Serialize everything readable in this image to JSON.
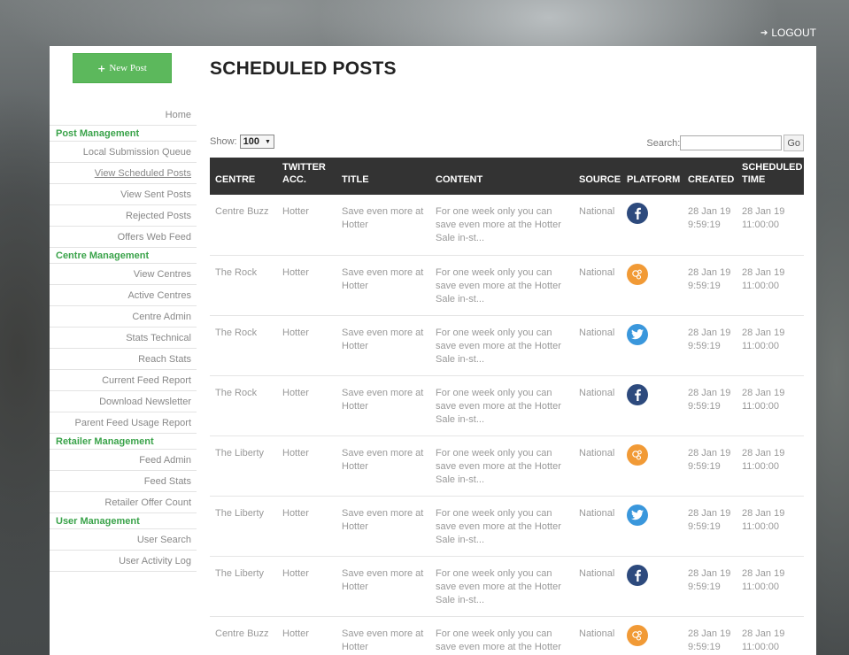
{
  "header": {
    "logout_label": "LOGOUT",
    "logout_icon": "sign-out-icon"
  },
  "sidebar": {
    "new_post_label": "New Post",
    "new_post_icon": "plus-icon",
    "items": [
      {
        "type": "link",
        "label": "Home"
      },
      {
        "type": "heading",
        "label": "Post Management"
      },
      {
        "type": "link",
        "label": "Local Submission Queue"
      },
      {
        "type": "link",
        "label": "View Scheduled Posts",
        "active": true
      },
      {
        "type": "link",
        "label": "View Sent Posts"
      },
      {
        "type": "link",
        "label": "Rejected Posts"
      },
      {
        "type": "link",
        "label": "Offers Web Feed"
      },
      {
        "type": "heading",
        "label": "Centre Management"
      },
      {
        "type": "link",
        "label": "View Centres"
      },
      {
        "type": "link",
        "label": "Active Centres"
      },
      {
        "type": "link",
        "label": "Centre Admin"
      },
      {
        "type": "link",
        "label": "Stats Technical"
      },
      {
        "type": "link",
        "label": "Reach Stats"
      },
      {
        "type": "link",
        "label": "Current Feed Report"
      },
      {
        "type": "link",
        "label": "Download Newsletter"
      },
      {
        "type": "link",
        "label": "Parent Feed Usage Report"
      },
      {
        "type": "heading",
        "label": "Retailer Management"
      },
      {
        "type": "link",
        "label": "Feed Admin"
      },
      {
        "type": "link",
        "label": "Feed Stats"
      },
      {
        "type": "link",
        "label": "Retailer Offer Count"
      },
      {
        "type": "heading",
        "label": "User Management"
      },
      {
        "type": "link",
        "label": "User Search"
      },
      {
        "type": "link",
        "label": "User Activity Log"
      }
    ]
  },
  "main": {
    "title": "SCHEDULED POSTS",
    "show_label": "Show:",
    "show_value": "100",
    "search_label": "Search:",
    "search_value": "",
    "go_label": "Go",
    "columns": [
      "CENTRE",
      "TWITTER ACC.",
      "TITLE",
      "CONTENT",
      "SOURCE",
      "PLATFORM",
      "CREATED",
      "SCHEDULED TIME"
    ],
    "rows": [
      {
        "centre": "Centre Buzz",
        "twitter": "Hotter",
        "title": "Save even more at Hotter",
        "content": "For one week only you can save even more at the Hotter Sale in-st...",
        "source": "National",
        "platform": "facebook",
        "created": "28 Jan 19 9:59:19",
        "scheduled": "28 Jan 19 11:00:00"
      },
      {
        "centre": "The Rock",
        "twitter": "Hotter",
        "title": "Save even more at Hotter",
        "content": "For one week only you can save even more at the Hotter Sale in-st...",
        "source": "National",
        "platform": "other",
        "created": "28 Jan 19 9:59:19",
        "scheduled": "28 Jan 19 11:00:00"
      },
      {
        "centre": "The Rock",
        "twitter": "Hotter",
        "title": "Save even more at Hotter",
        "content": "For one week only you can save even more at the Hotter Sale in-st...",
        "source": "National",
        "platform": "twitter",
        "created": "28 Jan 19 9:59:19",
        "scheduled": "28 Jan 19 11:00:00"
      },
      {
        "centre": "The Rock",
        "twitter": "Hotter",
        "title": "Save even more at Hotter",
        "content": "For one week only you can save even more at the Hotter Sale in-st...",
        "source": "National",
        "platform": "facebook",
        "created": "28 Jan 19 9:59:19",
        "scheduled": "28 Jan 19 11:00:00"
      },
      {
        "centre": "The Liberty",
        "twitter": "Hotter",
        "title": "Save even more at Hotter",
        "content": "For one week only you can save even more at the Hotter Sale in-st...",
        "source": "National",
        "platform": "other",
        "created": "28 Jan 19 9:59:19",
        "scheduled": "28 Jan 19 11:00:00"
      },
      {
        "centre": "The Liberty",
        "twitter": "Hotter",
        "title": "Save even more at Hotter",
        "content": "For one week only you can save even more at the Hotter Sale in-st...",
        "source": "National",
        "platform": "twitter",
        "created": "28 Jan 19 9:59:19",
        "scheduled": "28 Jan 19 11:00:00"
      },
      {
        "centre": "The Liberty",
        "twitter": "Hotter",
        "title": "Save even more at Hotter",
        "content": "For one week only you can save even more at the Hotter Sale in-st...",
        "source": "National",
        "platform": "facebook",
        "created": "28 Jan 19 9:59:19",
        "scheduled": "28 Jan 19 11:00:00"
      },
      {
        "centre": "Centre Buzz",
        "twitter": "Hotter",
        "title": "Save even more at Hotter",
        "content": "For one week only you can save even more at the Hotter Sale in-st...",
        "source": "National",
        "platform": "other",
        "created": "28 Jan 19 9:59:19",
        "scheduled": "28 Jan 19 11:00:00"
      }
    ]
  },
  "colors": {
    "accent_green": "#5cb85c",
    "heading_green": "#3aa34a",
    "table_header": "#333333",
    "facebook": "#2d4a7d",
    "twitter": "#3a97dc",
    "other": "#f19a36"
  }
}
